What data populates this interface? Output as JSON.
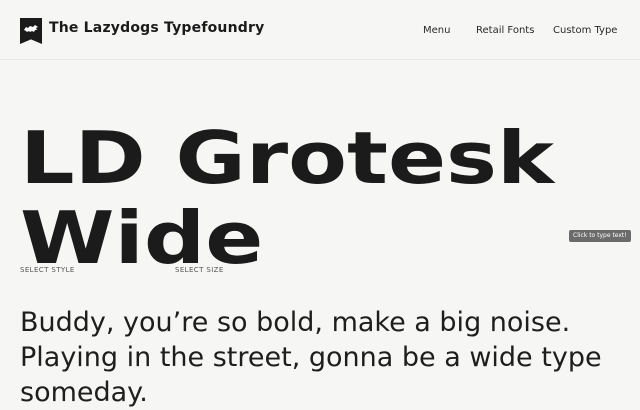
{
  "header": {
    "brand": "The Lazydogs Typefoundry",
    "logo_icon": "lion-icon",
    "nav": {
      "menu": "Menu",
      "retail_fonts": "Retail Fonts",
      "custom_type": "Custom Type"
    }
  },
  "hero": {
    "line1": "LD Grotesk",
    "line2": "Wide"
  },
  "tooltip": {
    "text": "Click to type text!"
  },
  "controls": {
    "select_style": "SELECT STYLE",
    "select_size": "SELECT SIZE"
  },
  "tester": {
    "text": "Buddy, you’re so bold, make a big noise. Playing in the street, gonna be a wide type someday."
  }
}
